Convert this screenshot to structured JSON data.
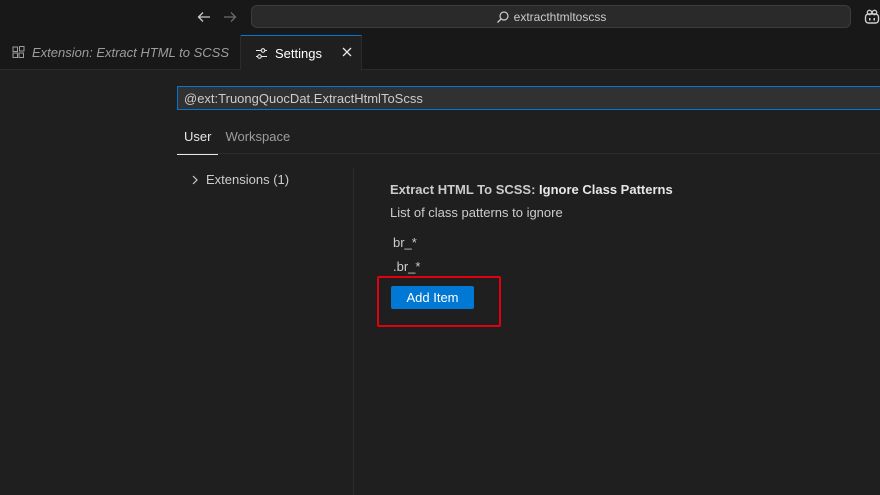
{
  "titlebar": {
    "back_icon": "arrow-left-icon",
    "forward_icon": "arrow-right-icon",
    "command_center_text": "extracthtmltoscss",
    "copilot_icon": "copilot-icon"
  },
  "tabs": [
    {
      "label": "Extension: Extract HTML to SCSS",
      "icon": "extensions-icon"
    },
    {
      "label": "Settings",
      "icon": "settings-sliders-icon",
      "active": true
    }
  ],
  "settings": {
    "search_value": "@ext:TruongQuocDat.ExtractHtmlToScss",
    "scope_tabs": [
      "User",
      "Workspace"
    ],
    "toc_item": "Extensions (1)",
    "setting": {
      "category": "Extract HTML To SCSS: ",
      "name": "Ignore Class Patterns",
      "description": "List of class patterns to ignore",
      "items": [
        "br_*",
        ".br_*"
      ],
      "add_label": "Add Item"
    }
  },
  "colors": {
    "accent": "#0078d4",
    "highlight": "#e0000e",
    "background": "#1f1f1f"
  }
}
